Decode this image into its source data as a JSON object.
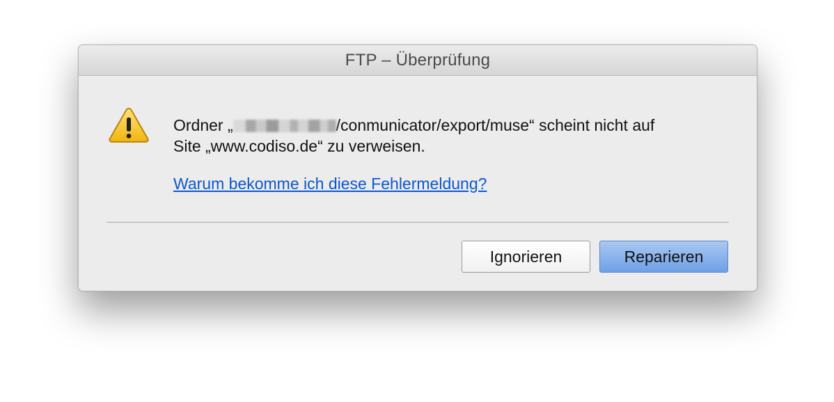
{
  "dialog": {
    "title": "FTP – Überprüfung",
    "message": {
      "line1_prefix": "Ordner „",
      "line1_suffix": "/conmunicator/export/muse“ scheint nicht auf",
      "line2": "Site „www.codiso.de“ zu verweisen."
    },
    "help_link": "Warum bekomme ich diese Fehlermeldung?",
    "buttons": {
      "ignore": "Ignorieren",
      "repair": "Reparieren"
    },
    "icon": "warning-icon",
    "colors": {
      "link": "#0b57d0",
      "primary_button": "#7faae9",
      "warning_fill": "#f6c21a"
    }
  }
}
